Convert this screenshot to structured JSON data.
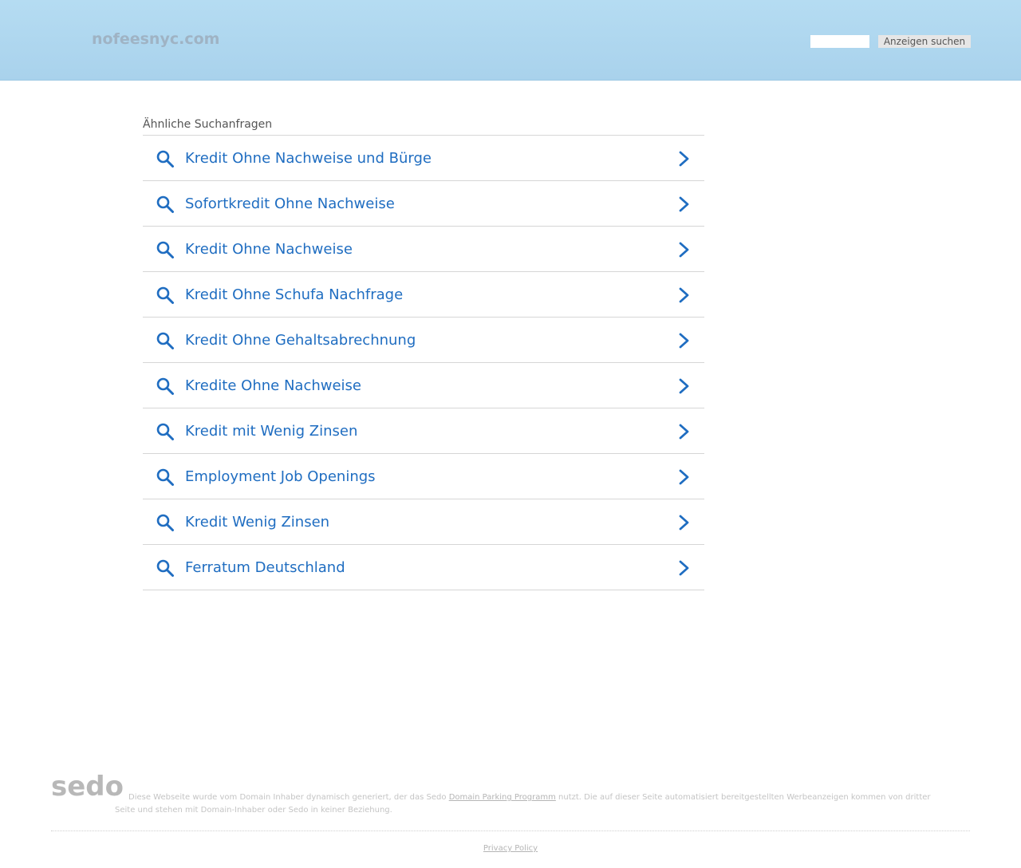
{
  "header": {
    "domain": "nofeesnyc.com",
    "search_placeholder": "",
    "search_button_label": "Anzeigen suchen"
  },
  "related": {
    "title": "Ähnliche Suchanfragen",
    "links": [
      {
        "label": "Kredit Ohne Nachweise und Bürge"
      },
      {
        "label": "Sofortkredit Ohne Nachweise"
      },
      {
        "label": "Kredit Ohne Nachweise"
      },
      {
        "label": "Kredit Ohne Schufa Nachfrage"
      },
      {
        "label": "Kredit Ohne Gehaltsabrechnung"
      },
      {
        "label": "Kredite Ohne Nachweise"
      },
      {
        "label": "Kredit mit Wenig Zinsen"
      },
      {
        "label": "Employment Job Openings"
      },
      {
        "label": "Kredit Wenig Zinsen"
      },
      {
        "label": "Ferratum Deutschland"
      }
    ],
    "link_color": "#1f6dc1"
  },
  "footer": {
    "logo": "sedo",
    "disclaimer_before": "Diese Webseite wurde vom Domain Inhaber dynamisch generiert, der das Sedo ",
    "disclaimer_link": "Domain Parking Programm",
    "disclaimer_after": " nutzt. Die auf dieser Seite automatisiert bereitgestellten Werbeanzeigen kommen von dritter Seite und stehen mit Domain-Inhaber oder Sedo in keiner Beziehung.",
    "privacy_label": "Privacy Policy"
  },
  "colors": {
    "header_bg": "#b5dcf2",
    "link": "#1f6dc1",
    "divider": "#d6d6d6"
  },
  "icons": {
    "row_left": "search-icon",
    "row_right": "chevron-right-icon"
  }
}
